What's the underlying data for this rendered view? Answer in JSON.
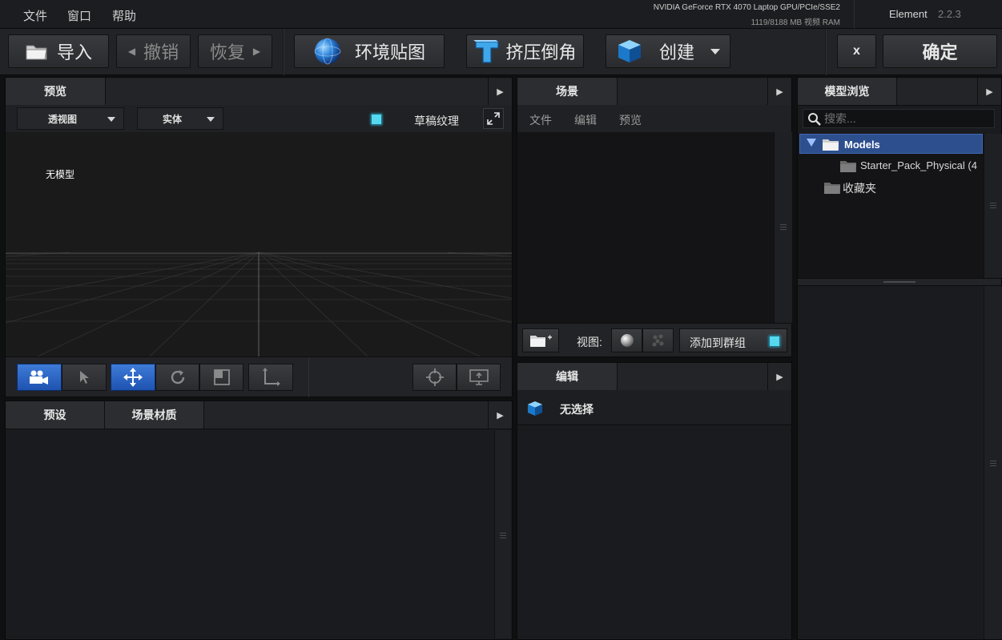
{
  "menubar": {
    "items": [
      "文件",
      "窗口",
      "帮助"
    ],
    "gpu_name": "NVIDIA GeForce RTX 4070 Laptop GPU/PCIe/SSE2",
    "gpu_mem": "1119/8188 MB 视频 RAM",
    "app_name": "Element",
    "app_version": "2.2.3"
  },
  "toolbar": {
    "import": "导入",
    "undo": "撤销",
    "redo": "恢复",
    "env_map": "环境贴图",
    "extrude": "挤压倒角",
    "create": "创建",
    "close": "x",
    "confirm": "确定"
  },
  "preview_panel": {
    "tab": "预览",
    "view_mode": "透视图",
    "shading_mode": "实体",
    "draft_texture_label": "草稿纹理",
    "no_model_text": "无模型"
  },
  "presets_panel": {
    "tabs": [
      "预设",
      "场景材质"
    ]
  },
  "scene_panel": {
    "tab": "场景",
    "menu": [
      "文件",
      "编辑",
      "预览"
    ],
    "view_label": "视图:",
    "add_to_group": "添加到群组"
  },
  "edit_panel": {
    "tab": "编辑",
    "no_selection": "无选择"
  },
  "model_browser": {
    "tab": "模型浏览",
    "search_placeholder": "搜索...",
    "tree": {
      "root": "Models",
      "child": "Starter_Pack_Physical (4",
      "favorites": "收藏夹"
    }
  },
  "colors": {
    "accent_blue": "#2a5cb8",
    "selection_blue": "#2d4f8e",
    "cyan_indicator": "#56d8f0",
    "panel_bg": "#1a1b1e"
  }
}
